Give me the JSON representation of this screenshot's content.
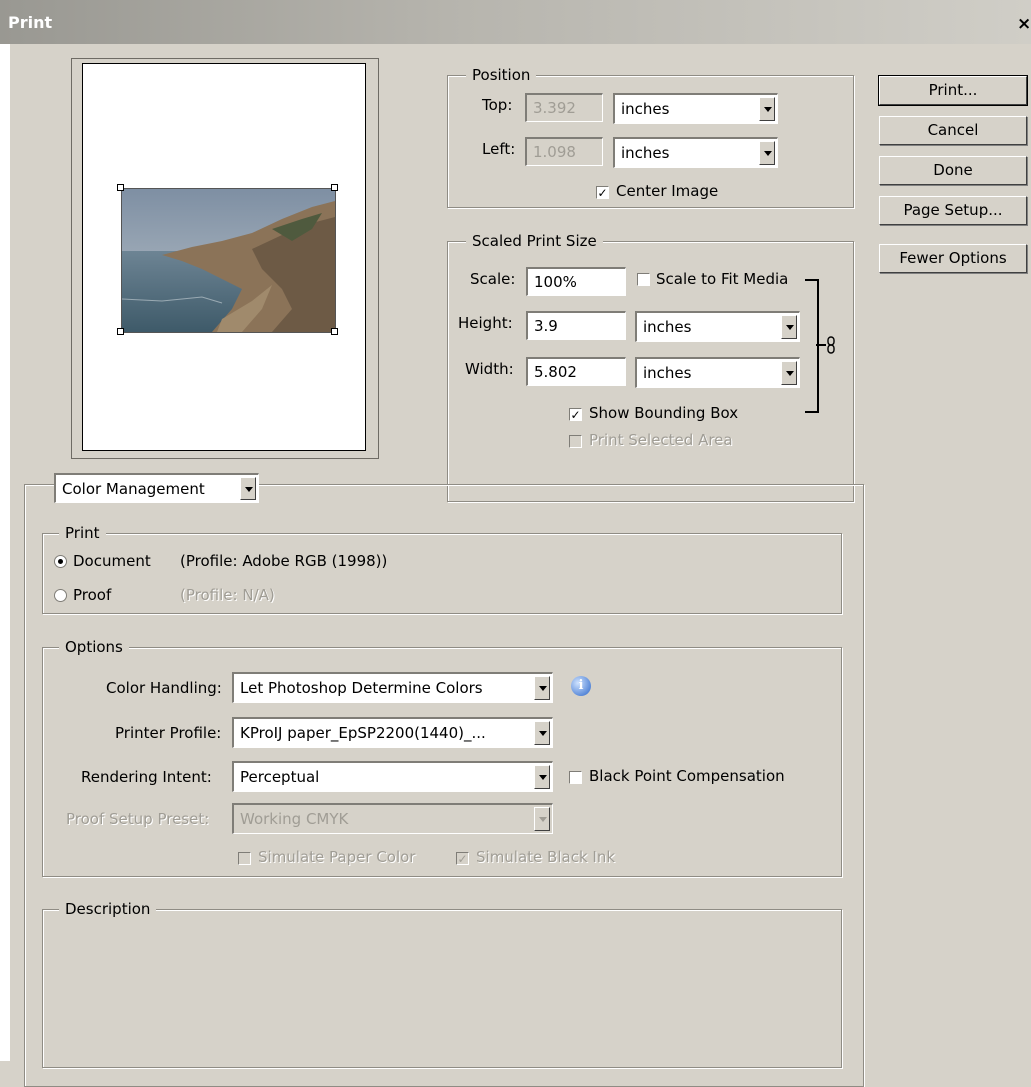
{
  "window": {
    "title": "Print",
    "close_glyph": "×"
  },
  "buttons": {
    "print": "Print...",
    "cancel": "Cancel",
    "done": "Done",
    "page_setup": "Page Setup...",
    "fewer_options": "Fewer Options"
  },
  "position": {
    "legend": "Position",
    "top_label": "Top:",
    "top_value": "3.392",
    "top_unit": "inches",
    "left_label": "Left:",
    "left_value": "1.098",
    "left_unit": "inches",
    "center_image_label": "Center Image",
    "center_image_checked": true
  },
  "scaled": {
    "legend": "Scaled Print Size",
    "scale_label": "Scale:",
    "scale_value": "100%",
    "scale_to_fit_label": "Scale to Fit Media",
    "height_label": "Height:",
    "height_value": "3.9",
    "height_unit": "inches",
    "width_label": "Width:",
    "width_value": "5.802",
    "width_unit": "inches",
    "show_bounding_box_label": "Show Bounding Box",
    "show_bounding_box_checked": true,
    "print_selected_area_label": "Print Selected Area"
  },
  "color_mgmt": {
    "dropdown": "Color Management",
    "print_legend": "Print",
    "document_label": "Document",
    "document_profile": "(Profile: Adobe RGB (1998))",
    "proof_label": "Proof",
    "proof_profile": "(Profile: N/A)",
    "options_legend": "Options",
    "color_handling_label": "Color Handling:",
    "color_handling_value": "Let Photoshop Determine Colors",
    "printer_profile_label": "Printer Profile:",
    "printer_profile_value": "KProIJ paper_EpSP2200(1440)_...",
    "rendering_intent_label": "Rendering Intent:",
    "rendering_intent_value": "Perceptual",
    "black_point_label": "Black Point Compensation",
    "proof_setup_label": "Proof Setup Preset:",
    "proof_setup_value": "Working CMYK",
    "simulate_paper_label": "Simulate Paper Color",
    "simulate_black_label": "Simulate Black Ink",
    "description_legend": "Description"
  },
  "icons": {
    "info": "info-icon",
    "link": "chain-link-icon",
    "check": "✓"
  }
}
